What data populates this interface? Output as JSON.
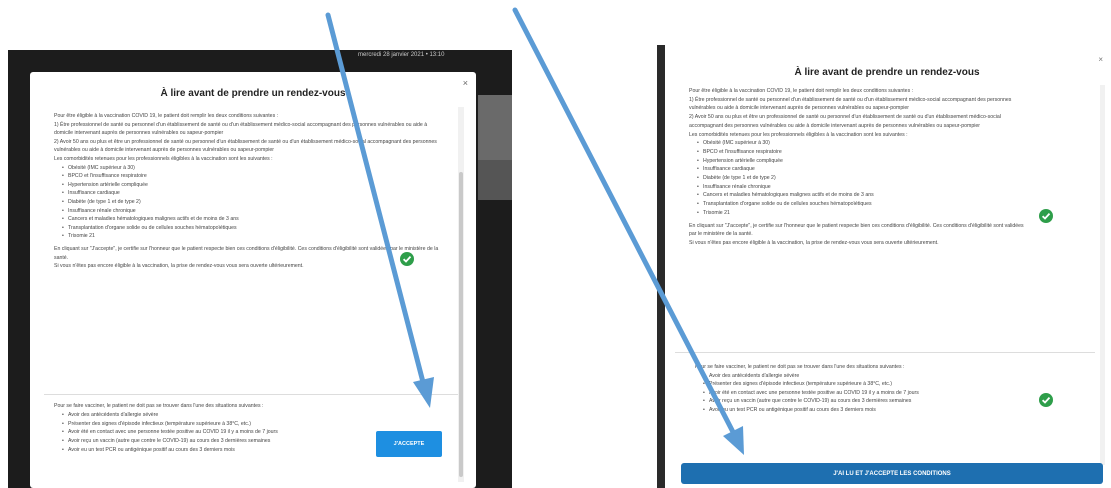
{
  "left": {
    "background_date": "mercredi 28 janvier 2021 • 13:10",
    "title": "À lire avant de prendre un rendez-vous",
    "close": "×",
    "intro": "Pour être éligible à la vaccination COVID 19, le patient doit remplir les deux conditions suivantes :",
    "cond1": "1) Être professionnel de santé ou personnel d'un établissement de santé ou d'un établissement médico-social accompagnant des personnes vulnérables ou aide à domicile intervenant auprès de personnes vulnérables ou sapeur-pompier",
    "cond2": "2) Avoir 50 ans ou plus et être un professionnel de santé ou personnel d'un établissement de santé ou d'un établissement médico-social accompagnant des personnes vulnérables ou aide à domicile intervenant auprès de personnes vulnérables ou sapeur-pompier",
    "comorb_intro": "Les comorbidités retenues pour les professionnels éligibles à la vaccination sont les suivantes :",
    "comorbidities": [
      "Obésité (IMC supérieur à 30)",
      "BPCO et l'insuffisance respiratoire",
      "Hypertension artérielle compliquée",
      "Insuffisance cardiaque",
      "Diabète (de type 1 et de type 2)",
      "Insuffisance rénale chronique",
      "Cancers et maladies hématologiques malignes actifs et de moins de 3 ans",
      "Transplantation d'organe solide ou de cellules souches hématopoïétiques",
      "Trisomie 21"
    ],
    "certify": "En cliquant sur \"J'accepte\", je certifie sur l'honneur que le patient respecte bien ces conditions d'éligibilité. Ces conditions d'éligibilité sont validées par le ministère de la santé.",
    "not_eligible": "Si vous n'êtes pas encore éligible à la vaccination, la prise de rendez-vous vous sera ouverte ultérieurement.",
    "exclusion_intro": "Pour se faire vacciner, le patient ne doit pas se trouver dans l'une des situations suivantes :",
    "exclusions": [
      "Avoir des antécédents d'allergie sévère",
      "Présenter des signes d'épisode infectieux (température supérieure à 38°C, etc.)",
      "Avoir été en contact avec une personne testée positive au COVID 19 il y a moins de 7 jours",
      "Avoir reçu un vaccin (autre que contre le COVID-19) au cours des 3 dernières semaines",
      "Avoir eu un test PCR ou antigénique positif au cours des 3 derniers mois"
    ],
    "accept_button": "J'ACCEPTE"
  },
  "right": {
    "title": "À lire avant de prendre un rendez-vous",
    "close": "×",
    "intro": "Pour être éligible à la vaccination COVID 19, le patient doit remplir les deux conditions suivantes :",
    "cond1": "1) Être professionnel de santé ou personnel d'un établissement de santé ou d'un établissement médico-social accompagnant des personnes vulnérables ou aide à domicile intervenant auprès de personnes vulnérables ou sapeur-pompier",
    "cond2": "2) Avoir 50 ans ou plus et être un professionnel de santé ou personnel d'un établissement de santé ou d'un établissement médico-social accompagnant des personnes vulnérables ou aide à domicile intervenant auprès de personnes vulnérables ou sapeur-pompier",
    "comorb_intro": "Les comorbidités retenues pour les professionnels éligibles à la vaccination sont les suivantes :",
    "comorbidities": [
      "Obésité (IMC supérieur à 30)",
      "BPCO et l'insuffisance respiratoire",
      "Hypertension artérielle compliquée",
      "Insuffisance cardiaque",
      "Diabète (de type 1 et de type 2)",
      "Insuffisance rénale chronique",
      "Cancers et maladies hématologiques malignes actifs et de moins de 3 ans",
      "Transplantation d'organe solide ou de cellules souches hématopoïétiques",
      "Trisomie 21"
    ],
    "certify": "En cliquant sur \"J'accepte\", je certifie sur l'honneur que le patient respecte bien ces conditions d'éligibilité. Ces conditions d'éligibilité sont validées par le ministère de la santé.",
    "not_eligible": "Si vous n'êtes pas encore éligible à la vaccination, la prise de rendez-vous vous sera ouverte ultérieurement.",
    "exclusion_intro": "Pour se faire vacciner, le patient ne doit pas se trouver dans l'une des situations suivantes :",
    "exclusions": [
      "Avoir des antécédents d'allergie sévère",
      "Présenter des signes d'épisode infectieux (température supérieure à 38°C, etc.)",
      "Avoir été en contact avec une personne testée positive au COVID 19 il y a moins de 7 jours",
      "Avoir reçu un vaccin (autre que contre le COVID-19) au cours des 3 dernières semaines",
      "Avoir eu un test PCR ou antigénique positif au cours des 3 derniers mois"
    ],
    "confirm_button": "J'AI LU ET J'ACCEPTE LES CONDITIONS"
  },
  "colors": {
    "arrow": "#5b9bd5",
    "accept_button": "#1e8fe1",
    "confirm_button": "#1e6fb0",
    "check": "#2e9e4a"
  },
  "icons": {
    "check": "check-circle-icon",
    "close": "close-icon"
  }
}
